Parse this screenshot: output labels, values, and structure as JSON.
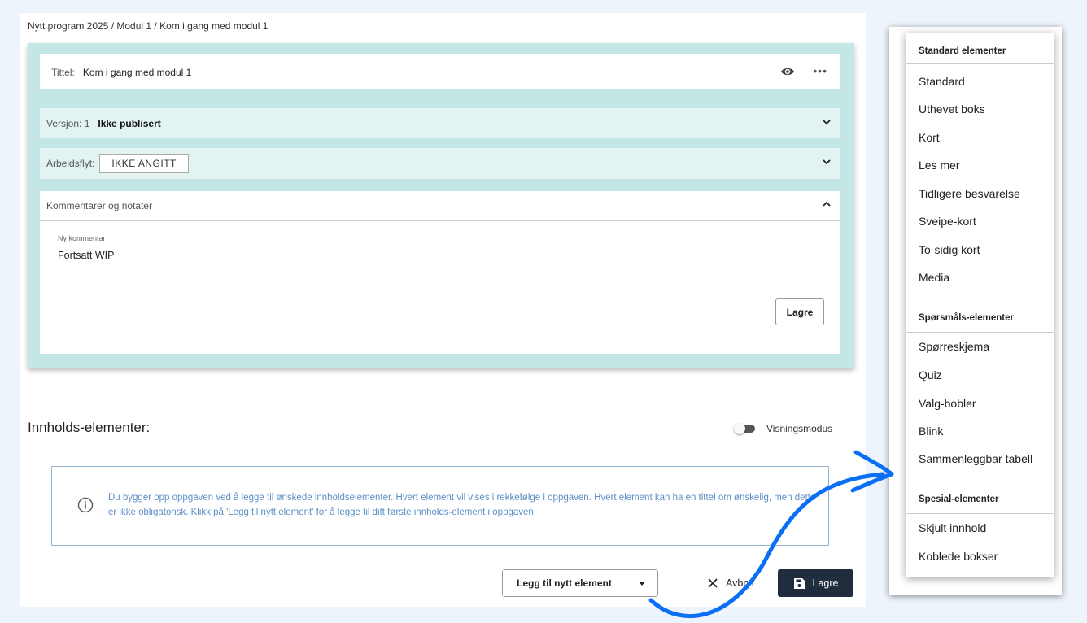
{
  "breadcrumb": "Nytt program 2025 / Modul 1 / Kom i gang med modul 1",
  "title": {
    "label": "Tittel:",
    "value": "Kom i gang med modul 1"
  },
  "version": {
    "label": "Versjon: 1",
    "status": "Ikke publisert"
  },
  "workflow": {
    "label": "Arbeidsflyt:",
    "value": "IKKE ANGITT"
  },
  "comments": {
    "header": "Kommentarer og notater",
    "field_label": "Ny kommentar",
    "field_value": "Fortsatt WIP",
    "save_label": "Lagre"
  },
  "content_section": {
    "title": "Innholds-elementer:",
    "toggle_label": "Visningsmodus",
    "info_text": "Du bygger opp oppgaven ved å legge til ønskede innholdselementer. Hvert element vil vises i rekkefølge i oppgaven. Hvert element kan ha en tittel om ønskelig, men dette er ikke obligatorisk. Klikk på 'Legg til nytt element' for å legge til ditt første innholds-element i oppgaven"
  },
  "actions": {
    "add_label": "Legg til nytt element",
    "cancel_label": "Avbryt",
    "save_label": "Lagre"
  },
  "dropdown": {
    "groups": [
      {
        "title": "Standard elementer",
        "items": [
          "Standard",
          "Uthevet boks",
          "Kort",
          "Les mer",
          "Tidligere besvarelse",
          "Sveipe-kort",
          "To-sidig kort",
          "Media"
        ]
      },
      {
        "title": "Spørsmåls-elementer",
        "items": [
          "Spørreskjema",
          "Quiz",
          "Valg-bobler",
          "Blink",
          "Sammenleggbar tabell"
        ]
      },
      {
        "title": "Spesial-elementer",
        "items": [
          "Skjult innhold",
          "Koblede bokser"
        ]
      }
    ]
  },
  "colors": {
    "teal": "#c4e7e6",
    "light_teal": "#e2f3f2",
    "info_blue": "#5b8fc7",
    "dark_button": "#1f2d3d",
    "arrow_blue": "#0b6ff5"
  }
}
